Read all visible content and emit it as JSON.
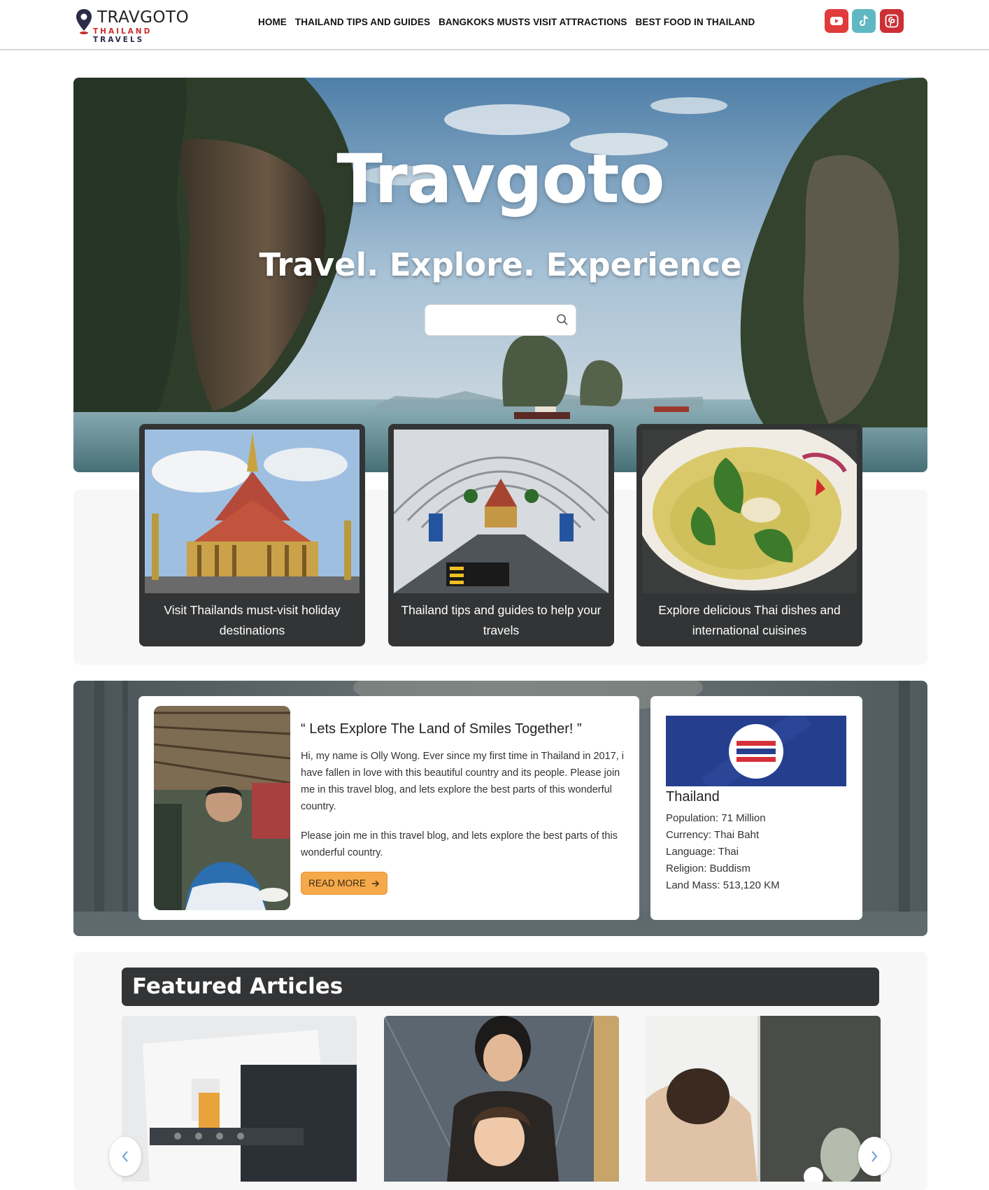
{
  "header": {
    "logo_title": "TRAVGOTO",
    "logo_sub_1": "THAILAND ",
    "logo_sub_2": "TRAVELS",
    "nav": [
      "HOME",
      "THAILAND TIPS AND GUIDES",
      "BANGKOKS MUSTS VISIT ATTRACTIONS",
      "BEST FOOD IN THAILAND"
    ],
    "social": [
      {
        "name": "youtube-icon",
        "color": "#e13b3b"
      },
      {
        "name": "tiktok-icon",
        "color": "#5fb8c2"
      },
      {
        "name": "pinterest-icon",
        "color": "#cc2f35"
      }
    ]
  },
  "hero": {
    "title": "Travgoto",
    "subtitle": "Travel. Explore. Experience",
    "search_value": "",
    "search_placeholder": ""
  },
  "cards": [
    {
      "caption": "Visit Thailands must-visit holiday destinations",
      "image": "temple"
    },
    {
      "caption": "Thailand tips and guides to help your travels",
      "image": "airport"
    },
    {
      "caption": "Explore delicious Thai dishes and international cuisines",
      "image": "curry"
    }
  ],
  "about": {
    "heading": "“ Lets Explore The Land of Smiles Together! ”",
    "para1": "Hi, my name is Olly Wong. Ever since my first time in Thailand in 2017, i have fallen in love with this beautiful country and its people. Please join me in this travel blog, and lets explore the best parts of this wonderful country.",
    "para2": "Please join me in this travel blog, and lets explore the best parts of this wonderful country.",
    "button": "READ MORE"
  },
  "facts": {
    "country": "Thailand",
    "lines": [
      "Population: 71 Million",
      "Currency: Thai Baht",
      "Language: Thai",
      "Religion: Buddism",
      "Land Mass: 513,120 KM"
    ]
  },
  "featured": {
    "title": "Featured Articles"
  },
  "colors": {
    "accent": "#f6a94a",
    "dark_panel": "#333435",
    "flag_blue": "#253f8e",
    "flag_red": "#d6303a"
  }
}
